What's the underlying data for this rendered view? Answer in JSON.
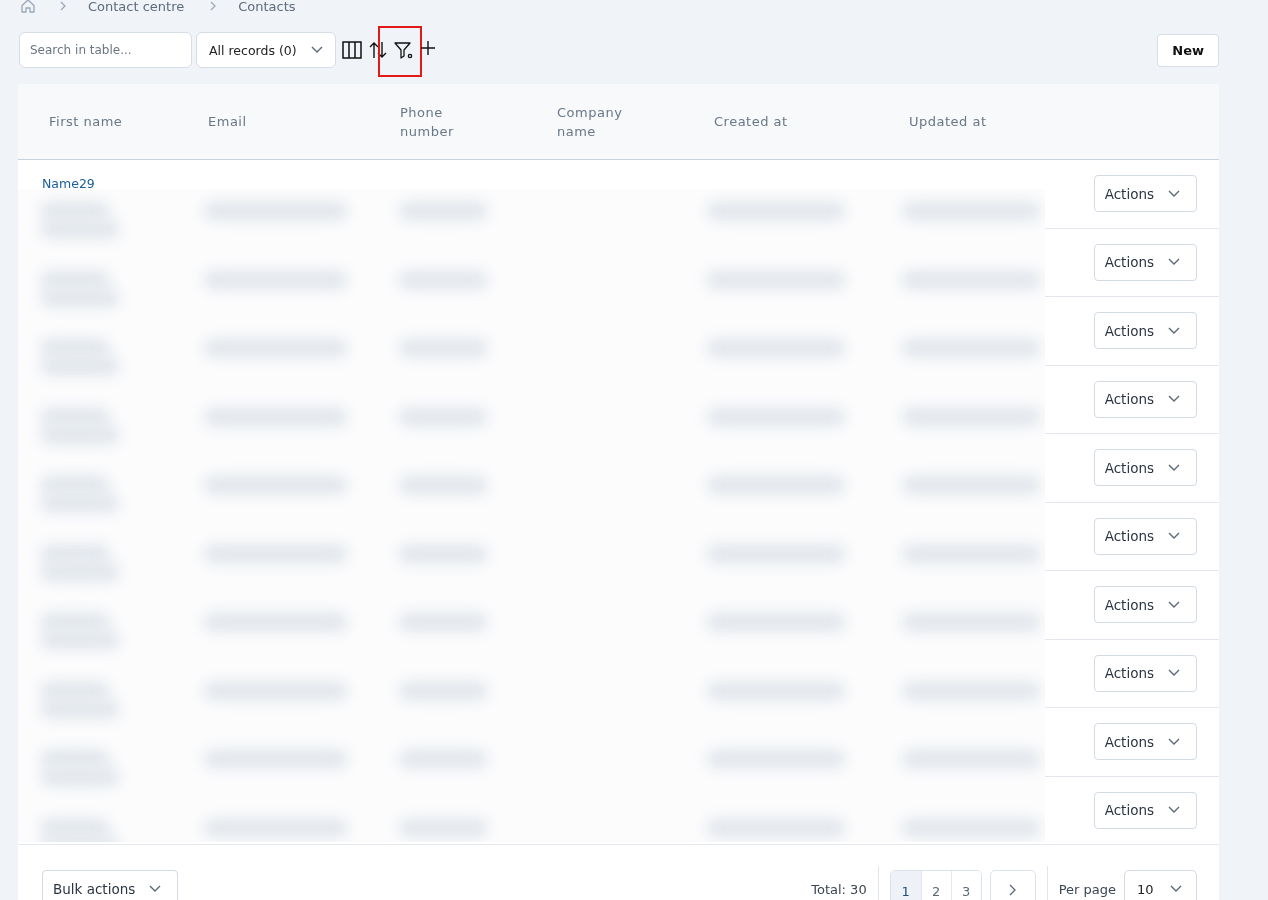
{
  "breadcrumb": [
    {
      "label": "Contact centre"
    },
    {
      "label": "Contacts"
    }
  ],
  "toolbar": {
    "search": {
      "placeholder": "Search in table..."
    },
    "view_select": {
      "value": "All records (0)"
    },
    "tools": [
      {
        "kind": "columns",
        "highlighted": false
      },
      {
        "kind": "sort",
        "highlighted": false
      },
      {
        "kind": "filter",
        "highlighted": true
      },
      {
        "kind": "add",
        "highlighted": false
      }
    ],
    "new_button": "New"
  },
  "table": {
    "columns": [
      "First name",
      "Email",
      "Phone number",
      "Company name",
      "Created at",
      "Updated at"
    ],
    "rows": [
      {
        "first_name": "Name29",
        "actions": "Actions"
      },
      {
        "actions": "Actions"
      },
      {
        "actions": "Actions"
      },
      {
        "actions": "Actions"
      },
      {
        "actions": "Actions"
      },
      {
        "actions": "Actions"
      },
      {
        "actions": "Actions"
      },
      {
        "actions": "Actions"
      },
      {
        "actions": "Actions"
      },
      {
        "actions": "Actions"
      }
    ],
    "blurred": true
  },
  "footer": {
    "bulk_actions": "Bulk actions",
    "total": "Total: 30",
    "pages": [
      {
        "label": "1",
        "selected": true
      },
      {
        "label": "2",
        "selected": false
      },
      {
        "label": "3",
        "selected": false
      }
    ],
    "per_page_label": "Per page",
    "per_page": "10"
  }
}
